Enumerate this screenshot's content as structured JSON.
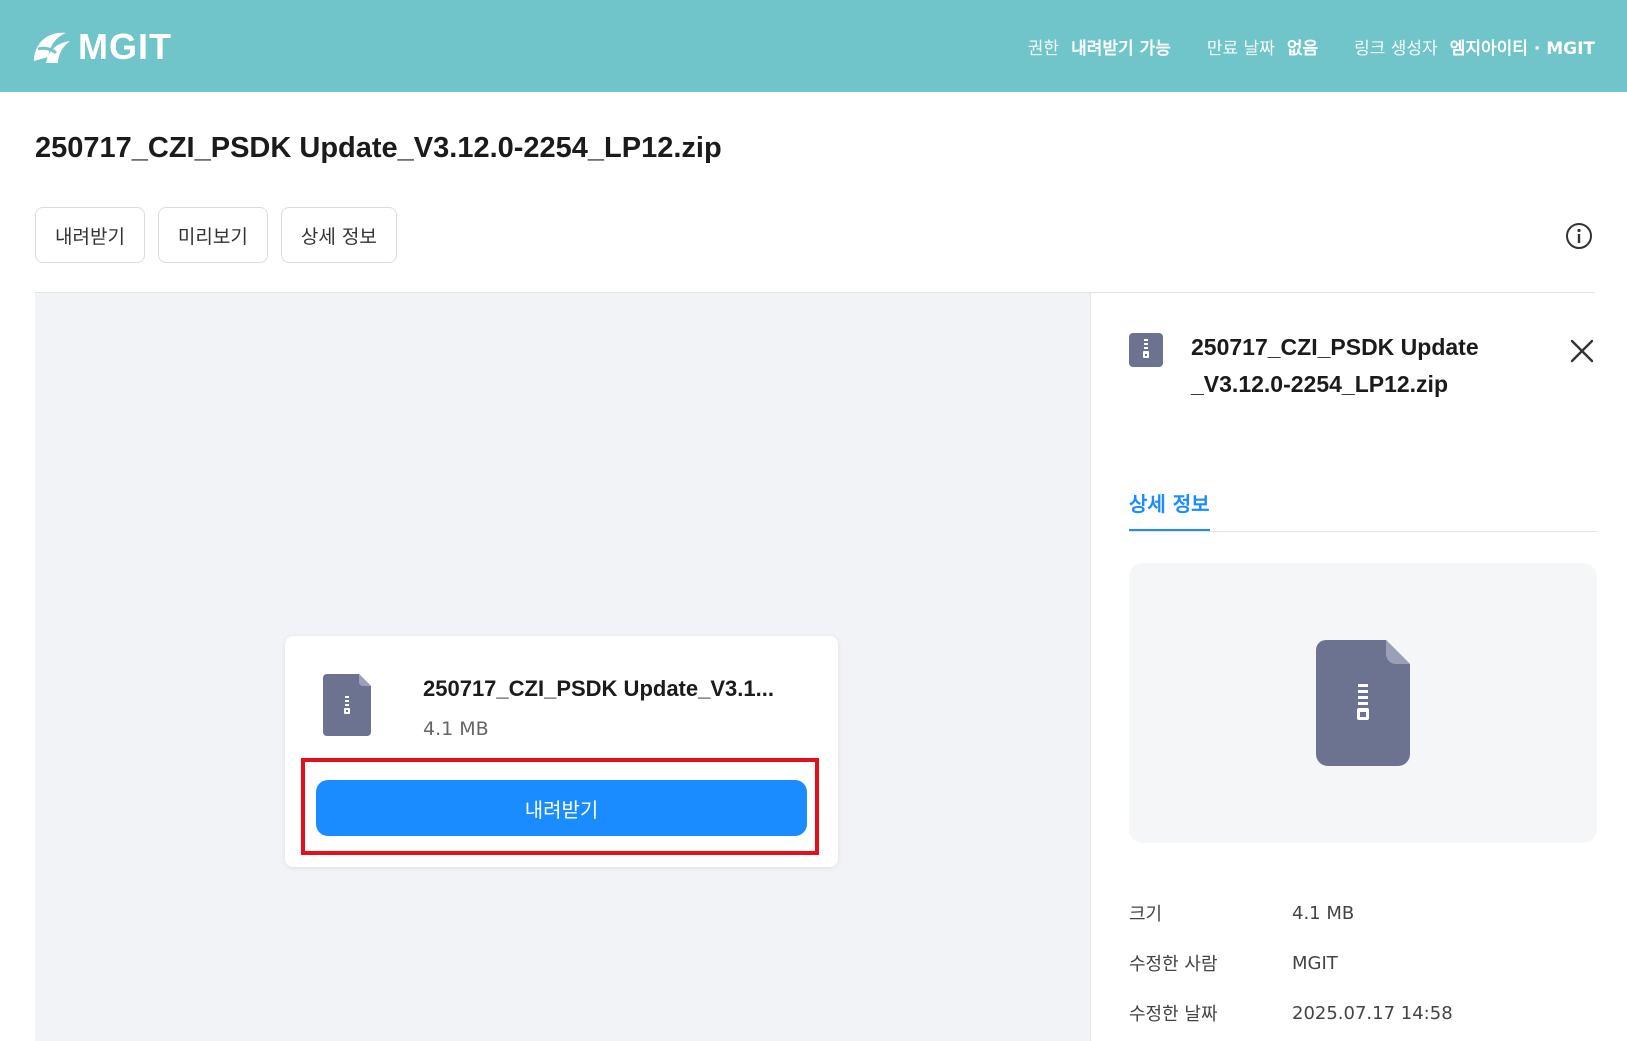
{
  "header": {
    "brand": "MGIT",
    "permission_label": "권한",
    "permission_value": "내려받기 가능",
    "expiry_label": "만료 날짜",
    "expiry_value": "없음",
    "creator_label": "링크 생성자",
    "creator_value": "엠지아이티 · MGIT",
    "bar_color": "#6fc5c9"
  },
  "file": {
    "title": "250717_CZI_PSDK Update_V3.12.0-2254_LP12.zip",
    "card_name": "250717_CZI_PSDK Update_V3.1...",
    "panel_name": "250717_CZI_PSDK Update_V3.12.0-2254_LP12.zip",
    "size": "4.1 MB",
    "icon": "zip-file-icon"
  },
  "toolbar": {
    "download_label": "내려받기",
    "preview_label": "미리보기",
    "details_label": "상세 정보",
    "info_icon": "info-icon"
  },
  "card": {
    "download_button_label": "내려받기",
    "accent": "#1a8cff",
    "highlight_color": "#e50f1b"
  },
  "panel": {
    "tab_label": "상세 정보",
    "close_icon": "close-icon",
    "properties": [
      {
        "label": "크기",
        "value": "4.1 MB"
      },
      {
        "label": "수정한 사람",
        "value": "MGIT"
      },
      {
        "label": "수정한 날짜",
        "value": "2025.07.17 14:58"
      }
    ]
  }
}
